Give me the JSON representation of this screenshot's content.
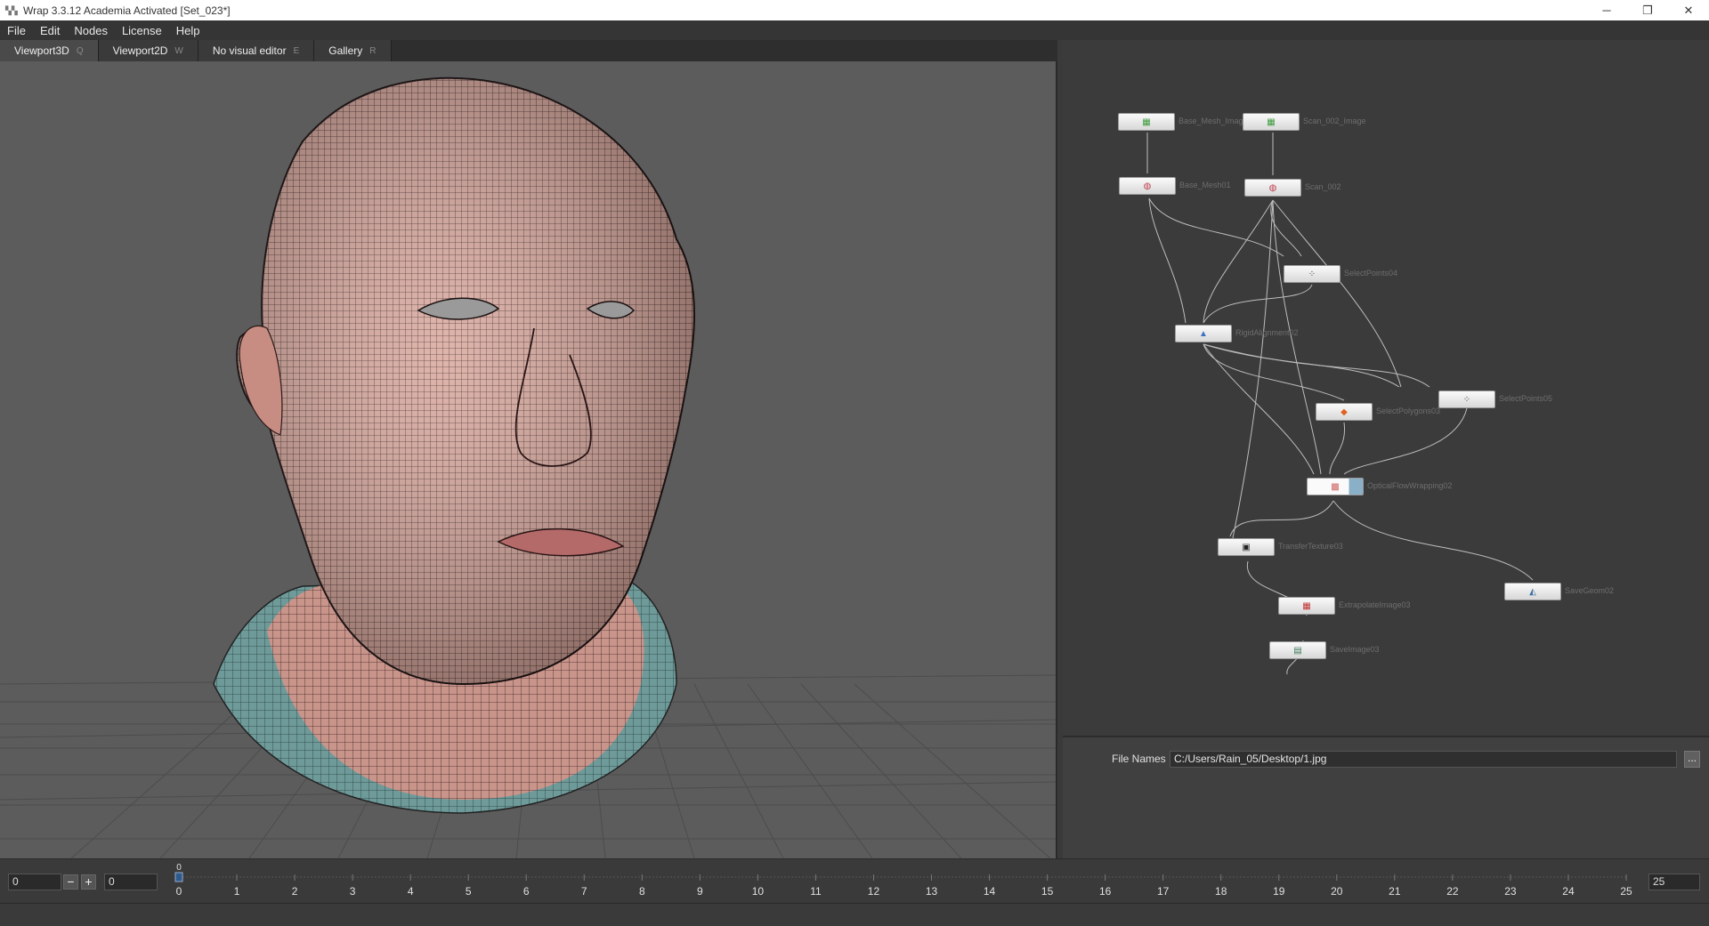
{
  "window": {
    "title": "Wrap 3.3.12 Academia Activated [Set_023*]",
    "controls": [
      "─",
      "❐",
      "✕"
    ]
  },
  "menu": [
    "File",
    "Edit",
    "Nodes",
    "License",
    "Help"
  ],
  "tabs": [
    {
      "label": "Viewport3D",
      "shortcut": "Q"
    },
    {
      "label": "Viewport2D",
      "shortcut": "W"
    },
    {
      "label": "No visual editor",
      "shortcut": "E"
    },
    {
      "label": "Gallery",
      "shortcut": "R"
    }
  ],
  "nodes": [
    {
      "label": "Base_Mesh_Image",
      "icon": "image-icon"
    },
    {
      "label": "Scan_002_Image",
      "icon": "image-icon"
    },
    {
      "label": "Base_Mesh01",
      "icon": "mesh-icon"
    },
    {
      "label": "Scan_002",
      "icon": "mesh-icon"
    },
    {
      "label": "SelectPoints04",
      "icon": "points-icon"
    },
    {
      "label": "RigidAlignment02",
      "icon": "align-icon"
    },
    {
      "label": "SelectPoints05",
      "icon": "points-icon"
    },
    {
      "label": "SelectPolygons03",
      "icon": "polygons-icon"
    },
    {
      "label": "OpticalFlowWrapping02",
      "icon": "wrap-icon"
    },
    {
      "label": "TransferTexture03",
      "icon": "texture-icon"
    },
    {
      "label": "SaveGeom02",
      "icon": "save-geom-icon"
    },
    {
      "label": "ExtrapolateImage03",
      "icon": "extrapolate-icon"
    },
    {
      "label": "SaveImage03",
      "icon": "save-image-icon"
    }
  ],
  "properties": {
    "file_names_label": "File Names",
    "file_names_value": "C:/Users/Rain_05/Desktop/1.jpg",
    "browse_label": "..."
  },
  "timeline": {
    "current_frame": "0",
    "minus": "−",
    "plus": "+",
    "frame_value": "0",
    "ticks": [
      "0",
      "1",
      "2",
      "3",
      "4",
      "5",
      "6",
      "7",
      "8",
      "9",
      "10",
      "11",
      "12",
      "13",
      "14",
      "15",
      "16",
      "17",
      "18",
      "19",
      "20",
      "21",
      "22",
      "23",
      "24",
      "25"
    ],
    "cursor_label": "0",
    "end_frame": "25"
  },
  "colors": {
    "panel_bg": "#3b3b3b",
    "viewport_bg": "#5c5c5c",
    "skin": "#d7a59a",
    "wire": "#2a1a1a"
  }
}
